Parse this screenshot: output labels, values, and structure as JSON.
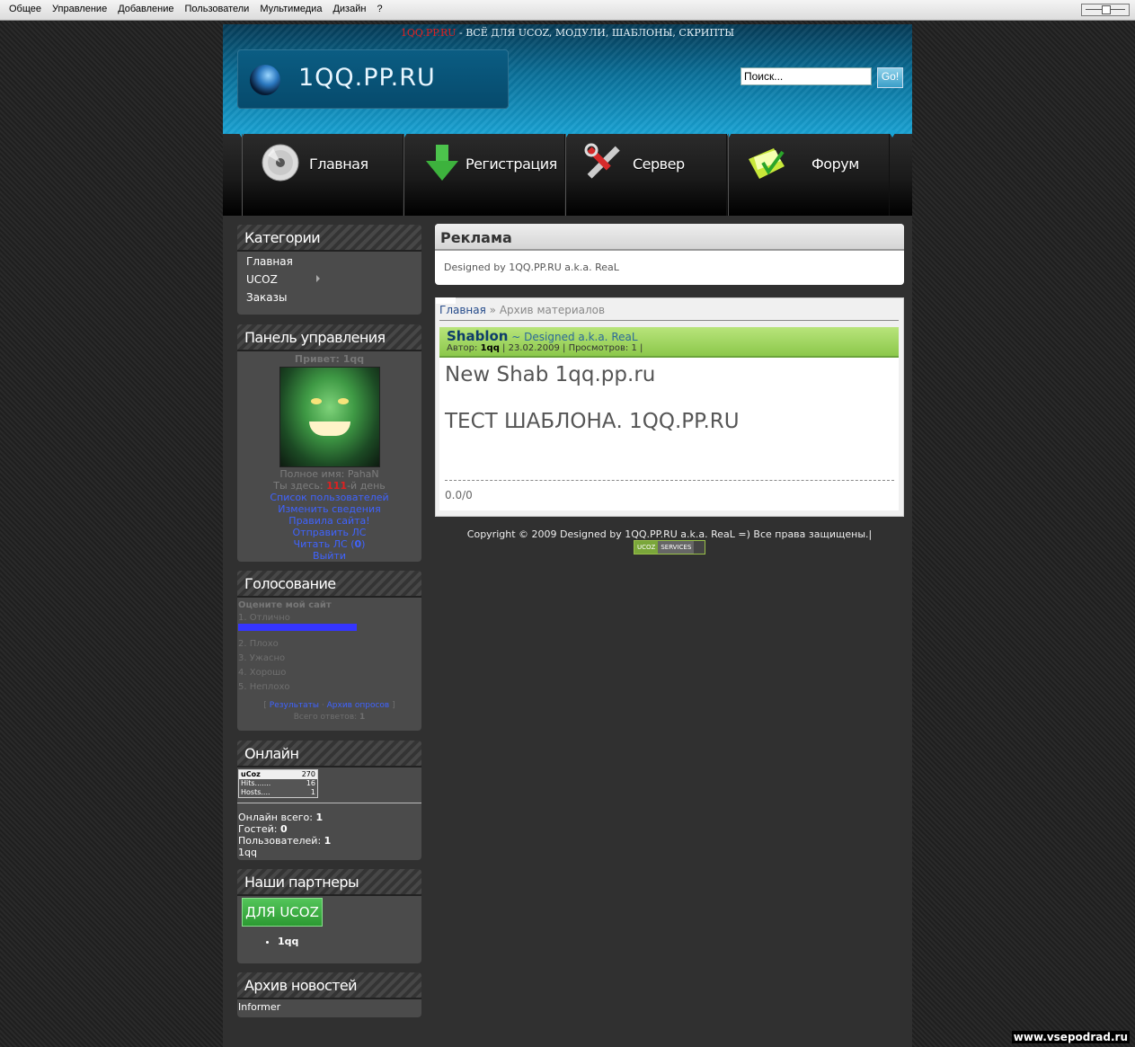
{
  "adminbar": {
    "items": [
      "Общее",
      "Управление",
      "Добавление",
      "Пользователи",
      "Мультимедиа",
      "Дизайн",
      "?"
    ]
  },
  "header": {
    "tagline_site": "1QQ.PP.RU",
    "tagline_rest": " - ВСЁ ДЛЯ UCOZ, МОДУЛИ, ШАБЛОНЫ, СКРИПТЫ",
    "logo_text": "1QQ.PP.RU",
    "search_value": "Поиск...",
    "search_button": "Go!"
  },
  "nav": [
    {
      "label": "Главная",
      "icon": "cd-disc-icon"
    },
    {
      "label": "Регистрация",
      "icon": "download-arrow-icon"
    },
    {
      "label": "Сервер",
      "icon": "tools-icon"
    },
    {
      "label": "Форум",
      "icon": "folder-icon"
    }
  ],
  "colors": {
    "accent": "#19a2d3",
    "link": "#3f63ff",
    "entry_green": "#8cc84b",
    "alert_red": "#e02020"
  },
  "sidebar": {
    "categories": {
      "title": "Категории",
      "items": [
        "Главная",
        "UCOZ",
        "Заказы"
      ]
    },
    "panel": {
      "title": "Панель управления",
      "greeting": "Привет: 1qq",
      "fullname": "Полное имя: PahaN",
      "days_prefix": "Ты здесь: ",
      "days_value": "111",
      "days_suffix": "-й день",
      "links": [
        "Список пользователей",
        "Изменить сведения",
        "Правила сайта!",
        "Отправить ЛС"
      ],
      "read_pm_prefix": "Читать ЛС (",
      "read_pm_count": "0",
      "read_pm_suffix": ")",
      "logout": "Выйти"
    },
    "poll": {
      "title": "Голосование",
      "question": "Оцените мой сайт",
      "options": [
        "1. Отлично",
        "2. Плохо",
        "3. Ужасно",
        "4. Хорошо",
        "5. Неплохо"
      ],
      "results_link": "Результаты",
      "archive_link": "Архив опросов",
      "total_label": "Всего ответов: ",
      "total": "1"
    },
    "online": {
      "title": "Онлайн",
      "counter": {
        "brand": "uCoz",
        "brand_value": "270",
        "hits_label": "Hits.......",
        "hits": "16",
        "hosts_label": "Hosts....",
        "hosts": "1"
      },
      "total_label": "Онлайн всего: ",
      "total": "1",
      "guests_label": "Гостей: ",
      "guests": "0",
      "users_label": "Пользователей: ",
      "users": "1",
      "user_list": "1qq"
    },
    "partners": {
      "title": "Наши партнеры",
      "button": "ДЛЯ UCOZ",
      "item": "1qq"
    },
    "news_archive": {
      "title": "Архив новостей",
      "informer": "Informer"
    }
  },
  "main": {
    "ad": {
      "title": "Реклама",
      "text": "Designed by 1QQ.PP.RU a.k.a. ReaL"
    },
    "breadcrumb": {
      "home": "Главная",
      "sep": " » ",
      "current": "Архив материалов"
    },
    "entry": {
      "title": "Shablon",
      "subtitle": " ~ Designed a.k.a. ReaL",
      "author_label": "Автор: ",
      "author": "1qq",
      "meta_rest": " | 23.02.2009 | Просмотров: 1 |",
      "line1": "New Shab 1qq.pp.ru",
      "line2": "ТЕСТ ШАБЛОНА. 1QQ.PP.RU",
      "rating": "0.0/0"
    },
    "footer": "Copyright © 2009 Designed by 1QQ.PP.RU a.k.a. ReaL =) Все права защищены.|",
    "badge": {
      "left": "UCOZ",
      "right": "SERVICES"
    }
  },
  "watermark": "www.vsepodrad.ru"
}
